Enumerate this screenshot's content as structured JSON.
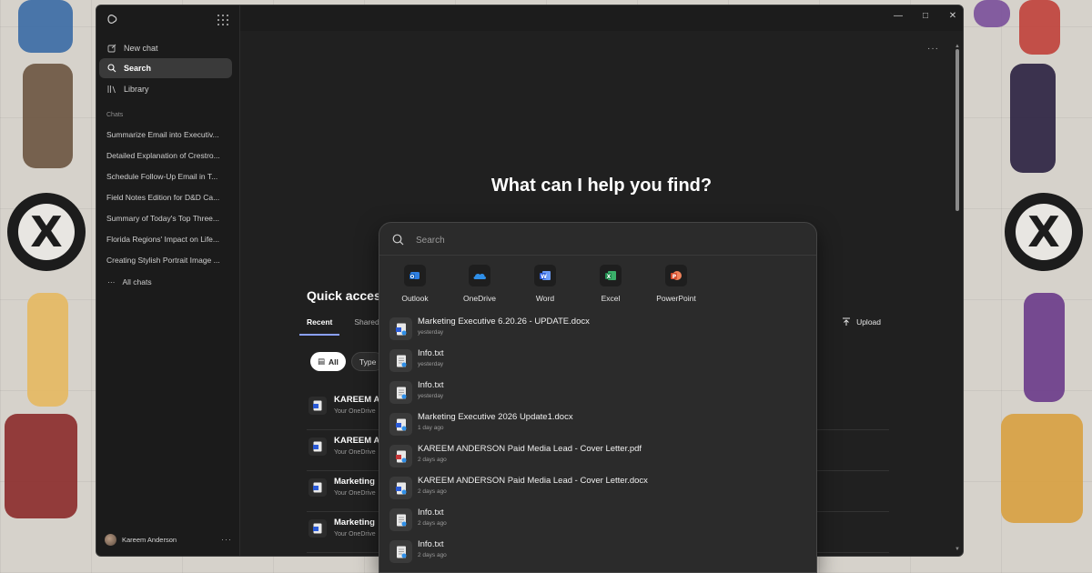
{
  "sidebar": {
    "nav": [
      {
        "label": "New chat",
        "icon": "edit-icon"
      },
      {
        "label": "Search",
        "icon": "search-icon",
        "active": true
      },
      {
        "label": "Library",
        "icon": "library-icon"
      }
    ],
    "chats_label": "Chats",
    "chats": [
      "Summarize Email into Executiv...",
      "Detailed Explanation of Crestro...",
      "Schedule Follow-Up Email in T...",
      "Field Notes Edition for D&D Ca...",
      "Summary of Today's Top Three...",
      "Florida Regions' Impact on Life...",
      "Creating Stylish Portrait Image ..."
    ],
    "all_chats_label": "All chats",
    "user_name": "Kareem Anderson"
  },
  "main": {
    "hero": "What can I help you find?",
    "quick_access_title": "Quick acces",
    "tabs": [
      "Recent",
      "Shared"
    ],
    "upload_label": "Upload",
    "chips": [
      "All",
      "Type"
    ],
    "rows": [
      {
        "name": "KAREEM A",
        "location": "Your OneDrive"
      },
      {
        "name": "KAREEM A",
        "location": "Your OneDrive"
      },
      {
        "name": "Marketing",
        "location": "Your OneDrive"
      },
      {
        "name": "Marketing",
        "location": "Your OneDrive"
      }
    ]
  },
  "search_popup": {
    "placeholder": "Search",
    "apps": [
      {
        "label": "Outlook",
        "icon": "outlook-icon",
        "color": "#2f7fe0"
      },
      {
        "label": "OneDrive",
        "icon": "onedrive-icon",
        "color": "#2f8fe8"
      },
      {
        "label": "Word",
        "icon": "word-icon",
        "color": "#2b5bd7"
      },
      {
        "label": "Excel",
        "icon": "excel-icon",
        "color": "#1f8a4c"
      },
      {
        "label": "PowerPoint",
        "icon": "powerpoint-icon",
        "color": "#d2492a"
      }
    ],
    "results": [
      {
        "name": "Marketing Executive 6.20.26 - UPDATE.docx",
        "time": "yesterday",
        "kind": "word"
      },
      {
        "name": "Info.txt",
        "time": "yesterday",
        "kind": "txt"
      },
      {
        "name": "Info.txt",
        "time": "yesterday",
        "kind": "txt"
      },
      {
        "name": "Marketing Executive 2026 Update1.docx",
        "time": "1 day ago",
        "kind": "word"
      },
      {
        "name": "KAREEM ANDERSON Paid Media Lead - Cover Letter.pdf",
        "time": "2 days ago",
        "kind": "pdf"
      },
      {
        "name": "KAREEM ANDERSON Paid Media Lead - Cover Letter.docx",
        "time": "2 days ago",
        "kind": "word"
      },
      {
        "name": "Info.txt",
        "time": "2 days ago",
        "kind": "txt"
      },
      {
        "name": "Info.txt",
        "time": "2 days ago",
        "kind": "txt"
      }
    ]
  },
  "colors": {
    "accent": "#8aa0ff",
    "window_bg": "#202020",
    "sidebar_bg": "#1b1b1b",
    "popup_bg": "#2b2b2b"
  }
}
